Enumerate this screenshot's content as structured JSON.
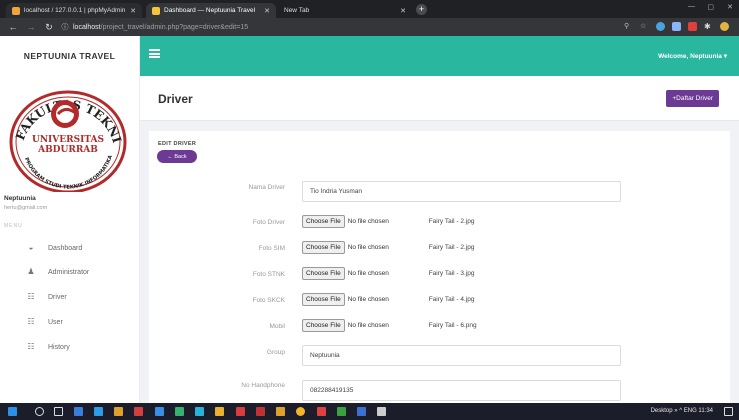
{
  "browser": {
    "tabs": [
      {
        "label": "localhost / 127.0.0.1 | phpMyAdmin"
      },
      {
        "label": "Dashboard — Neptuunia Travel"
      },
      {
        "label": "New Tab"
      }
    ],
    "url_host": "localhost",
    "url_path": "/project_travel/admin.php?page=driver&edit=15"
  },
  "app": {
    "brand": "NEPTUUNIA TRAVEL",
    "welcome": "Welcome, Neptuunia",
    "accent": "#2ab7a0",
    "purple": "#6c3a95"
  },
  "logo": {
    "arc_text": "FAKULTAS TEKNIK",
    "university": "UNIVERSITAS",
    "university_name": "ABDURRAB",
    "bottom_text": "PROGRAM STUDI TEKNIK INFORMATIKA"
  },
  "sidebar": {
    "user_name": "Neptuunia",
    "user_email": "hertu@gmail.com",
    "menu_label": "MENU",
    "items": [
      {
        "label": "Dashboard",
        "icon": "dashboard-icon"
      },
      {
        "label": "Administrator",
        "icon": "user-icon"
      },
      {
        "label": "Driver",
        "icon": "group-icon"
      },
      {
        "label": "User",
        "icon": "group-icon"
      },
      {
        "label": "History",
        "icon": "group-icon"
      }
    ]
  },
  "page": {
    "title": "Driver",
    "daftar_button": "+Daftar Driver"
  },
  "form": {
    "title": "EDIT DRIVER",
    "back_button": "← Back",
    "choose_label": "Choose File",
    "no_file": "No file chosen",
    "fields": {
      "nama": {
        "label": "Nama Driver",
        "value": "Tio Indria Yusman"
      },
      "foto_driver": {
        "label": "Foto Driver",
        "file": "Fairy Tail - 2.jpg"
      },
      "foto_sim": {
        "label": "Foto SIM",
        "file": "Fairy Tail - 2.jpg"
      },
      "foto_stnk": {
        "label": "Foto STNK",
        "file": "Fairy Tail - 3.jpg"
      },
      "foto_skck": {
        "label": "Foto SKCK",
        "file": "Fairy Tail - 4.jpg"
      },
      "mobil": {
        "label": "Mobil",
        "file": "Fairy Tail - 6.png"
      },
      "group": {
        "label": "Group",
        "value": "Neptuunia"
      },
      "no_hp": {
        "label": "No Handphone",
        "value": "082288419135"
      }
    }
  },
  "taskbar": {
    "tray_text": "Desktop  »  ^  ENG  11:34"
  }
}
